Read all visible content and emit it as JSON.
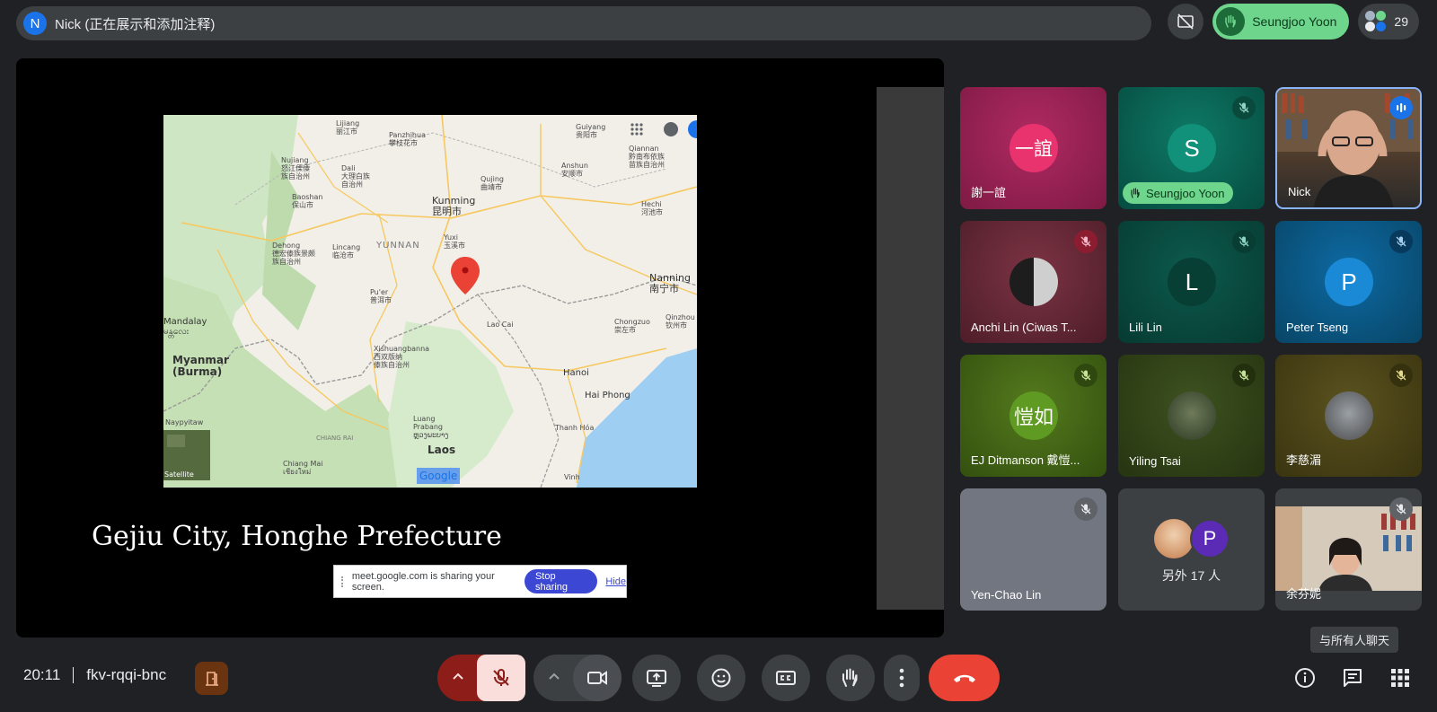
{
  "presenter": {
    "initial": "N",
    "label": "Nick (正在展示和添加注释)"
  },
  "top_right": {
    "hand_raiser": "Seungjoo Yoon",
    "participant_count": "29"
  },
  "slide": {
    "caption": "Gejiu City, Honghe Prefecture",
    "map_labels": [
      {
        "text": "Lijiang\n丽江市"
      },
      {
        "text": "Panzhihua\n攀枝花市"
      },
      {
        "text": "Guiyang\n贵阳市"
      },
      {
        "text": "Qiannan\n黔南布依族\n苗族自治州"
      },
      {
        "text": "Nujiang\n怒江傈僳\n族自治州"
      },
      {
        "text": "Dali\n大理白族\n自治州"
      },
      {
        "text": "Qujing\n曲靖市"
      },
      {
        "text": "Anshun\n安顺市"
      },
      {
        "text": "Baoshan\n保山市"
      },
      {
        "text": "Kunming\n昆明市"
      },
      {
        "text": "Hechi\n河池市"
      },
      {
        "text": "Dehong\n德宏傣族景颇\n族自治州"
      },
      {
        "text": "Lincang\n临沧市"
      },
      {
        "text": "YUNNAN"
      },
      {
        "text": "Yuxi\n玉溪市"
      },
      {
        "text": "Nanning\n南宁市"
      },
      {
        "text": "Pu'er\n普洱市"
      },
      {
        "text": "Mandalay\nမန္တလေး"
      },
      {
        "text": "Lao Cai"
      },
      {
        "text": "Chongzuo\n崇左市"
      },
      {
        "text": "Qinzhou\n钦州市"
      },
      {
        "text": "Myanmar\n(Burma)"
      },
      {
        "text": "Xishuangbanna\n西双版纳\n傣族自治州"
      },
      {
        "text": "Hanoi"
      },
      {
        "text": "Hai Phong"
      },
      {
        "text": "Naypyitaw"
      },
      {
        "text": "Luang\nPrabang\nຫຼວງພະບາງ"
      },
      {
        "text": "Thanh Hóa"
      },
      {
        "text": "CHIANG RAI"
      },
      {
        "text": "Laos"
      },
      {
        "text": "Chiang Mai\nเชียงใหม่"
      },
      {
        "text": "Vinh"
      }
    ],
    "satellite_label": "Satellite",
    "google_logo": "Google"
  },
  "share_bar": {
    "message": "meet.google.com is sharing your screen.",
    "stop_label": "Stop sharing",
    "hide_label": "Hide"
  },
  "tiles": [
    {
      "name": "謝一誼",
      "avatar_text": "一誼",
      "muted": false,
      "bg": "#8e1d4e"
    },
    {
      "name": "",
      "avatar_text": "S",
      "muted": true,
      "bg": "#0a5a4c",
      "hand_label": "Seungjoo Yoon"
    },
    {
      "name": "Nick",
      "avatar_text": "",
      "muted": false,
      "bg": "#6a5a4a",
      "speaking": true
    },
    {
      "name": "Anchi Lin (Ciwas T...",
      "avatar_text": "",
      "muted": true,
      "bg": "#5e2330"
    },
    {
      "name": "Lili Lin",
      "avatar_text": "L",
      "muted": true,
      "bg": "#0b4a3f"
    },
    {
      "name": "Peter Tseng",
      "avatar_text": "P",
      "muted": true,
      "bg": "#0a4f7a"
    },
    {
      "name": "EJ Ditmanson 戴愷...",
      "avatar_text": "愷如",
      "muted": true,
      "bg": "#3e5a14"
    },
    {
      "name": "Yiling Tsai",
      "avatar_text": "",
      "muted": true,
      "bg": "#2d3d17"
    },
    {
      "name": "李慈湄",
      "avatar_text": "",
      "muted": true,
      "bg": "#4a4414"
    },
    {
      "name": "Yen-Chao Lin",
      "avatar_text": "",
      "muted": true,
      "bg": "#6b6f78"
    },
    {
      "name": "另外 17 人",
      "avatar_text": "P",
      "muted": false,
      "bg": "#3c4043"
    },
    {
      "name": "余芬妮",
      "avatar_text": "",
      "muted": true,
      "bg": "#3c4043"
    }
  ],
  "tooltip": "与所有人聊天",
  "bottom": {
    "time": "20:11",
    "meeting_code": "fkv-rqqi-bnc"
  },
  "colors": {
    "leave": "#ea4335",
    "mic_muted_bg": "#f9dedc",
    "mic_group": "#8c1d18",
    "accent": "#8ab4f8"
  },
  "icons": [
    "chevron-up-icon",
    "mic-off-icon",
    "camera-icon",
    "present-icon",
    "emoji-icon",
    "captions-icon",
    "hand-icon",
    "more-icon",
    "end-call-icon",
    "info-icon",
    "chat-icon",
    "activities-icon"
  ]
}
